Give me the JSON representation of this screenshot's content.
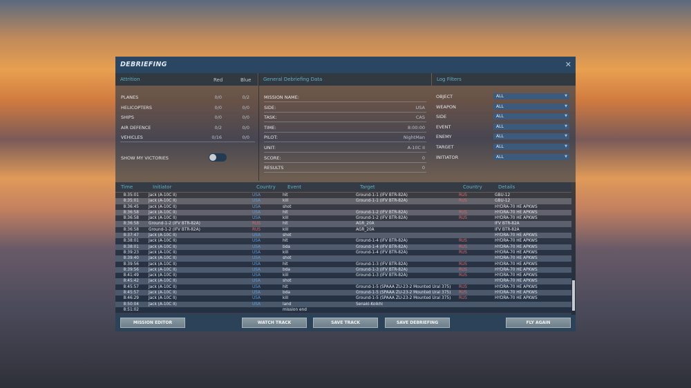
{
  "window": {
    "title": "DEBRIEFING",
    "close_icon": "close-icon"
  },
  "attrition": {
    "header": "Attrition",
    "red": "Red",
    "blue": "Blue",
    "rows": [
      {
        "label": "PLANES",
        "red": "0/0",
        "blue": "0/2"
      },
      {
        "label": "HELICOPTERS",
        "red": "0/0",
        "blue": "0/0"
      },
      {
        "label": "SHIPS",
        "red": "0/0",
        "blue": "0/0"
      },
      {
        "label": "AIR DEFENCE",
        "red": "0/2",
        "blue": "0/0"
      },
      {
        "label": "VEHICLES",
        "red": "0/16",
        "blue": "0/0"
      }
    ],
    "show_victories": "SHOW MY VICTORIES",
    "show_victories_on": false
  },
  "general": {
    "header": "General Debriefing Data",
    "rows": [
      {
        "label": "MISSION NAME:",
        "value": ""
      },
      {
        "label": "SIDE:",
        "value": "USA"
      },
      {
        "label": "TASK:",
        "value": "CAS"
      },
      {
        "label": "TIME:",
        "value": "8:00:00"
      },
      {
        "label": "PILOT:",
        "value": "NightMan"
      },
      {
        "label": "UNIT:",
        "value": "A-10C II"
      },
      {
        "label": "SCORE:",
        "value": "0"
      },
      {
        "label": "RESULTS",
        "value": "0"
      }
    ]
  },
  "filters": {
    "header": "Log Filters",
    "rows": [
      {
        "label": "OBJECT",
        "value": "ALL"
      },
      {
        "label": "WEAPON",
        "value": "ALL"
      },
      {
        "label": "SIDE",
        "value": "ALL"
      },
      {
        "label": "EVENT",
        "value": "ALL"
      },
      {
        "label": "ENEMY",
        "value": "ALL"
      },
      {
        "label": "TARGET",
        "value": "ALL"
      },
      {
        "label": "INITIATOR",
        "value": "ALL"
      }
    ]
  },
  "log": {
    "columns": [
      "Time",
      "Initiator",
      "Country",
      "Event",
      "Target",
      "Country",
      "Details"
    ],
    "rows": [
      [
        "8:35:01",
        "Jack (A-10C II)",
        "USA",
        "hit",
        "Ground-1-1 (IFV BTR-82A)",
        "RUS",
        "GBU-12"
      ],
      [
        "8:35:01",
        "Jack (A-10C II)",
        "USA",
        "kill",
        "Ground-1-1 (IFV BTR-82A)",
        "RUS",
        "GBU-12"
      ],
      [
        "8:36:45",
        "Jack (A-10C II)",
        "USA",
        "shot",
        "",
        "",
        "HYDRA-70 HE APKWS"
      ],
      [
        "8:36:58",
        "Jack (A-10C II)",
        "USA",
        "hit",
        "Ground-1-2 (IFV BTR-82A)",
        "RUS",
        "HYDRA-70 HE APKWS"
      ],
      [
        "8:36:58",
        "Jack (A-10C II)",
        "USA",
        "kill",
        "Ground-1-2 (IFV BTR-82A)",
        "RUS",
        "HYDRA-70 HE APKWS"
      ],
      [
        "8:36:58",
        "Ground-1-2 (IFV BTR-82A)",
        "RUS",
        "hit",
        "AGR_20A",
        "",
        "IFV BTR-82A"
      ],
      [
        "8:36:58",
        "Ground-1-2 (IFV BTR-82A)",
        "RUS",
        "kill",
        "AGR_20A",
        "",
        "IFV BTR-82A"
      ],
      [
        "8:37:47",
        "Jack (A-10C II)",
        "USA",
        "shot",
        "",
        "",
        "HYDRA-70 HE APKWS"
      ],
      [
        "8:38:01",
        "Jack (A-10C II)",
        "USA",
        "hit",
        "Ground-1-4 (IFV BTR-82A)",
        "RUS",
        "HYDRA-70 HE APKWS"
      ],
      [
        "8:38:01",
        "Jack (A-10C II)",
        "USA",
        "bda",
        "Ground-1-4 (IFV BTR-82A)",
        "RUS",
        "HYDRA-70 HE APKWS"
      ],
      [
        "8:39:23",
        "Jack (A-10C II)",
        "USA",
        "kill",
        "Ground-1-4 (IFV BTR-82A)",
        "RUS",
        "HYDRA-70 HE APKWS"
      ],
      [
        "8:39:40",
        "Jack (A-10C II)",
        "USA",
        "shot",
        "",
        "",
        "HYDRA-70 HE APKWS"
      ],
      [
        "8:39:56",
        "Jack (A-10C II)",
        "USA",
        "hit",
        "Ground-1-3 (IFV BTR-82A)",
        "RUS",
        "HYDRA-70 HE APKWS"
      ],
      [
        "8:39:56",
        "Jack (A-10C II)",
        "USA",
        "bda",
        "Ground-1-3 (IFV BTR-82A)",
        "RUS",
        "HYDRA-70 HE APKWS"
      ],
      [
        "8:41:49",
        "Jack (A-10C II)",
        "USA",
        "kill",
        "Ground-1-3 (IFV BTR-82A)",
        "RUS",
        "HYDRA-70 HE APKWS"
      ],
      [
        "8:45:42",
        "Jack (A-10C II)",
        "USA",
        "shot",
        "",
        "",
        "HYDRA-70 HE APKWS"
      ],
      [
        "8:45:57",
        "Jack (A-10C II)",
        "USA",
        "hit",
        "Ground-1-5 (SPAAA ZU-23-2 Mounted Ural 375)",
        "RUS",
        "HYDRA-70 HE APKWS"
      ],
      [
        "8:45:57",
        "Jack (A-10C II)",
        "USA",
        "bda",
        "Ground-1-5 (SPAAA ZU-23-2 Mounted Ural 375)",
        "RUS",
        "HYDRA-70 HE APKWS"
      ],
      [
        "8:46:29",
        "Jack (A-10C II)",
        "USA",
        "kill",
        "Ground-1-5 (SPAAA ZU-23-2 Mounted Ural 375)",
        "RUS",
        "HYDRA-70 HE APKWS"
      ],
      [
        "8:50:04",
        "Jack (A-10C II)",
        "USA",
        "land",
        "Senaki-Kolkhi",
        "",
        ""
      ],
      [
        "8:51:02",
        "",
        "",
        "mission end",
        "",
        "",
        ""
      ]
    ]
  },
  "buttons": {
    "mission_editor": "MISSION EDITOR",
    "watch_track": "WATCH TRACK",
    "save_track": "SAVE TRACK",
    "save_debriefing": "SAVE DEBRIEFING",
    "fly_again": "FLY AGAIN"
  },
  "colors": {
    "usa": "#5a9ad8",
    "rus": "#d86a6a",
    "accent": "#5fb0c8"
  }
}
